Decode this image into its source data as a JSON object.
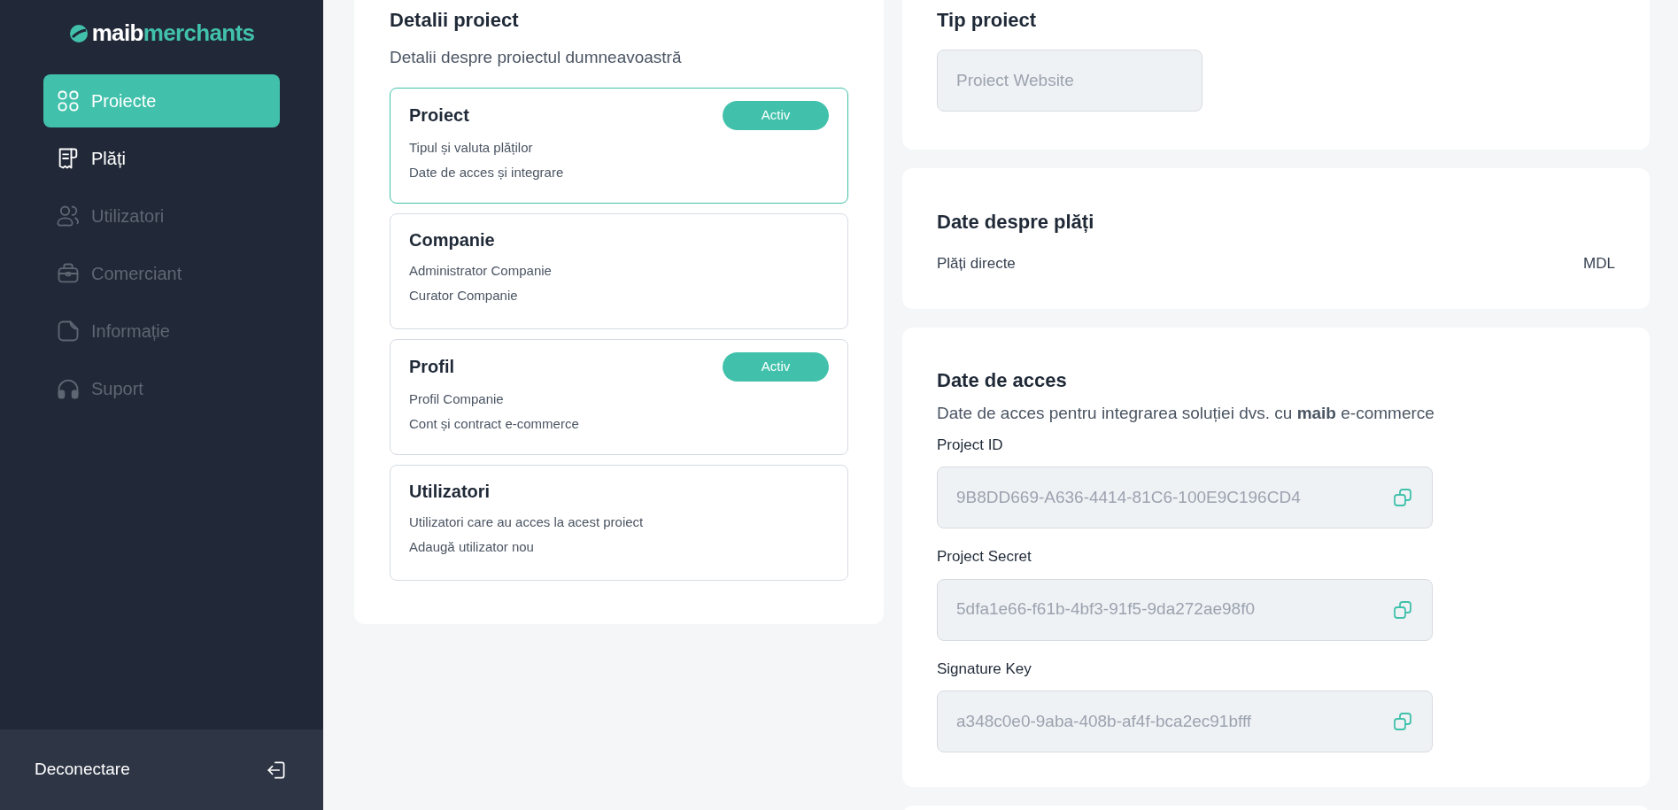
{
  "logo": {
    "prefix": "maib",
    "suffix": "merchants"
  },
  "sidebar": {
    "items": [
      {
        "label": "Proiecte",
        "kind": "grid",
        "selected": true,
        "disabled": false
      },
      {
        "label": "Plăți",
        "kind": "receipt",
        "selected": false,
        "disabled": false
      },
      {
        "label": "Utilizatori",
        "kind": "users",
        "selected": false,
        "disabled": true
      },
      {
        "label": "Comerciant",
        "kind": "briefcase",
        "selected": false,
        "disabled": true
      },
      {
        "label": "Informație",
        "kind": "note",
        "selected": false,
        "disabled": true
      },
      {
        "label": "Suport",
        "kind": "headphones",
        "selected": false,
        "disabled": true
      }
    ],
    "logout": "Deconectare"
  },
  "details": {
    "title": "Detalii proiect",
    "subtitle": "Detalii despre proiectul dumneavoastră",
    "sections": [
      {
        "title": "Proiect",
        "badge": "Activ",
        "selected": true,
        "lines": [
          "Tipul și valuta plăților",
          "Date de acces și integrare"
        ]
      },
      {
        "title": "Companie",
        "selected": false,
        "lines": [
          "Administrator Companie",
          "Curator Companie"
        ]
      },
      {
        "title": "Profil",
        "badge": "Activ",
        "selected": false,
        "lines": [
          "Profil Companie",
          "Cont și contract e-commerce"
        ]
      },
      {
        "title": "Utilizatori",
        "selected": false,
        "lines": [
          "Utilizatori care au acces la acest proiect",
          "Adaugă utilizator nou"
        ]
      }
    ]
  },
  "project_type": {
    "title": "Tip proiect",
    "value": "Proiect Website"
  },
  "payments": {
    "title": "Date despre plăți",
    "rows": [
      {
        "label": "Plăți directe",
        "value": "MDL"
      }
    ]
  },
  "access": {
    "title": "Date de acces",
    "description": "Date de acces pentru integrarea soluției dvs. cu **maib** e-commerce",
    "fields": [
      {
        "label": "Project ID",
        "value": "9B8DD669-A636-4414-81C6-100E9C196CD4"
      },
      {
        "label": "Project Secret",
        "value": "5dfa1e66-f61b-4bf3-91f5-9da272ae98f0"
      },
      {
        "label": "Signature Key",
        "value": "a348c0e0-9aba-408b-af4f-bca2ec91bfff"
      }
    ]
  }
}
